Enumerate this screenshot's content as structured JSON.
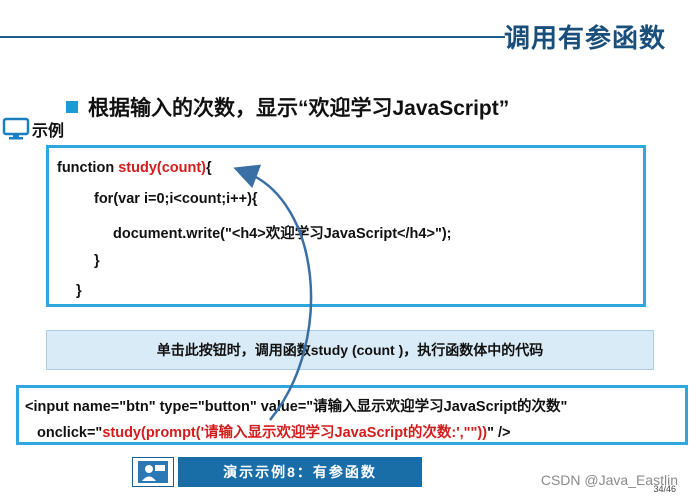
{
  "slide": {
    "title": "调用有参函数",
    "headline": "根据输入的次数，显示“欢迎学习JavaScript”",
    "example_label": "示例"
  },
  "code": {
    "line1_fn": "function ",
    "line1_name": "study(count)",
    "line1_brace": "{",
    "line2": "for(var i=0;i<count;i++){",
    "line3": "document.write(\"<h4>欢迎学习JavaScript</h4>\");",
    "line4": "}",
    "line5": "}"
  },
  "description": "单击此按钮时，调用函数study (count )，执行函数体中的代码",
  "html_code": {
    "line1": "<input name=\"btn\" type=\"button\" value=\"请输入显示欢迎学习JavaScript的次数\"",
    "line2_pre": "onclick=\"",
    "line2_red": "study(prompt('请输入显示欢迎学习JavaScript的次数:',\"\"))",
    "line2_post": "\" />"
  },
  "demo": {
    "label": "演示示例8：有参函数",
    "icon": "presenter-icon"
  },
  "watermark": "CSDN @Java_Eastlin",
  "page_number": "34/46",
  "colors": {
    "title": "#1a4f7c",
    "box_border": "#2ea7de",
    "highlight": "#d31c1c",
    "arrow": "#3a6fa6"
  }
}
